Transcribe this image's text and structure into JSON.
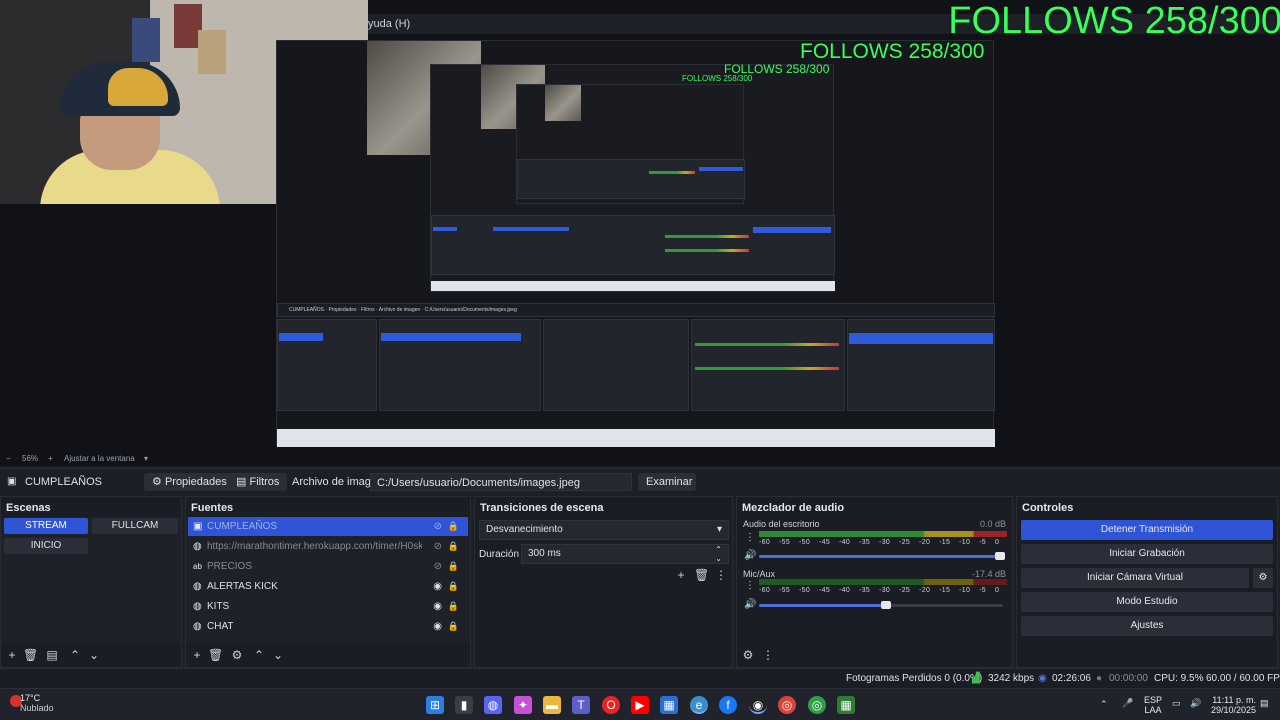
{
  "preview": {
    "overlay_text": "FOLLOWS 258/300",
    "menubar_fragment": "yuda (H)",
    "zoom_level": "56%",
    "fit_label": "Ajustar a la ventana"
  },
  "context_bar": {
    "scene_name": "CUMPLEAÑOS",
    "properties_label": "Propiedades",
    "filters_label": "Filtros",
    "image_file_label": "Archivo de imagen",
    "image_path": "C:/Users/usuario/Documents/images.jpeg",
    "browse_label": "Examinar"
  },
  "scenes": {
    "title": "Escenas",
    "items": [
      {
        "label": "STREAM",
        "active": true
      },
      {
        "label": "FULLCAM",
        "active": false
      },
      {
        "label": "INICIO",
        "active": false
      }
    ]
  },
  "sources": {
    "title": "Fuentes",
    "items": [
      {
        "icon": "image-icon",
        "glyph": "▣",
        "label": "CUMPLEAÑOS",
        "active": true,
        "visible": false
      },
      {
        "icon": "browser-icon",
        "glyph": "◍",
        "label": "https://marathontimer.herokuapp.com/timer/H0skXn",
        "active": false,
        "visible": false
      },
      {
        "icon": "text-icon",
        "glyph": "ab",
        "label": "PRECIOS",
        "active": false,
        "visible": false
      },
      {
        "icon": "browser-icon",
        "glyph": "◍",
        "label": "ALERTAS KICK",
        "active": false,
        "visible": true
      },
      {
        "icon": "browser-icon",
        "glyph": "◍",
        "label": "KITS",
        "active": false,
        "visible": true
      },
      {
        "icon": "browser-icon",
        "glyph": "◍",
        "label": "CHAT",
        "active": false,
        "visible": true
      }
    ]
  },
  "transitions": {
    "title": "Transiciones de escena",
    "selected": "Desvanecimiento",
    "duration_label": "Duración",
    "duration_value": "300 ms"
  },
  "mixer": {
    "title": "Mezclador de audio",
    "scale": [
      "-60",
      "-55",
      "-50",
      "-45",
      "-40",
      "-35",
      "-30",
      "-25",
      "-20",
      "-15",
      "-10",
      "-5",
      "0"
    ],
    "channels": [
      {
        "name": "Audio del escritorio",
        "db": "0.0 dB",
        "level": 1.0,
        "volume": 1.0
      },
      {
        "name": "Mic/Aux",
        "db": "-17.4 dB",
        "level": 0.0,
        "volume": 0.52
      }
    ]
  },
  "controls": {
    "title": "Controles",
    "buttons": [
      {
        "label": "Detener Transmisión",
        "active": true
      },
      {
        "label": "Iniciar Grabación",
        "active": false
      },
      {
        "label": "Iniciar Cámara Virtual",
        "active": false
      },
      {
        "label": "Modo Estudio",
        "active": false
      },
      {
        "label": "Ajustes",
        "active": false
      }
    ]
  },
  "status": {
    "dropped_frames": "Fotogramas Perdidos 0 (0.0%)",
    "bitrate": "3242 kbps",
    "stream_time": "02:26:06",
    "record_time": "00:00:00",
    "cpu": "CPU: 9.5%",
    "fps": "60.00 / 60.00 FPS"
  },
  "taskbar": {
    "temperature": "17°C",
    "weather": "Nublado",
    "lang_top": "ESP",
    "lang_bottom": "LAA",
    "time": "11:11 p. m.",
    "date": "29/10/2025"
  },
  "colors": {
    "accent": "#2f54d6",
    "overlay_green": "#39ff5a",
    "panel_bg": "#1b1d24"
  }
}
